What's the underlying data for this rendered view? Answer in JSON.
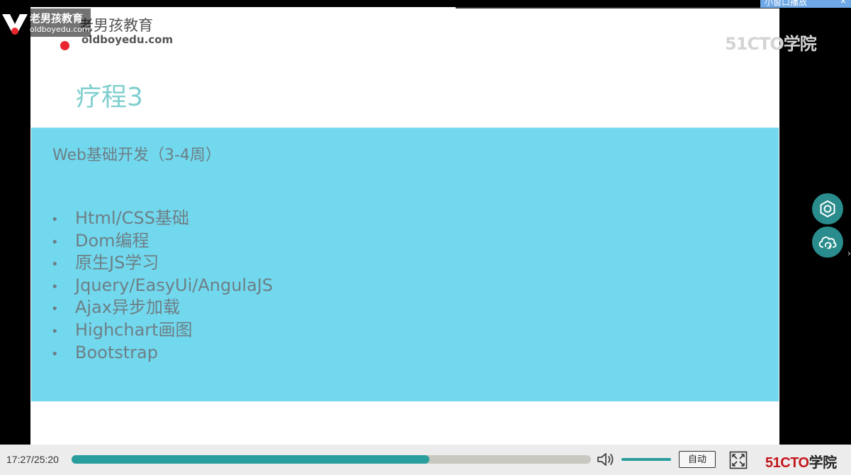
{
  "slide": {
    "logo_cn": "老男孩教育",
    "logo_url": "oldboyedu.com",
    "watermark": "51CTO学院",
    "title": "疗程3",
    "section_heading": "Web基础开发（3-4周）",
    "bullets": [
      "Html/CSS基础",
      "Dom编程",
      "原生JS学习",
      "Jquery/EasyUi/AngulaJS",
      "Ajax异步加载",
      "Highchart画图",
      "Bootstrap"
    ]
  },
  "overlay_logo": {
    "name_cn": "老男孩教育",
    "url": "oldboyedu.com"
  },
  "pip_chip": {
    "label": "小窗口播放",
    "close": "×"
  },
  "side_buttons": {
    "settings": "settings-icon",
    "cloud": "cloud-sync-icon",
    "arrow": "›"
  },
  "player": {
    "current_time": "17:27",
    "total_time": "25:20",
    "progress": 0.689,
    "volume": 1.0,
    "quality_label": "自动",
    "brand_51cto": "51CTO",
    "brand_suffix": "学院"
  },
  "colors": {
    "accent": "#2a9d9d",
    "content_box": "#72d8ee",
    "title": "#7fcfce",
    "brand_red": "#c4161c"
  }
}
